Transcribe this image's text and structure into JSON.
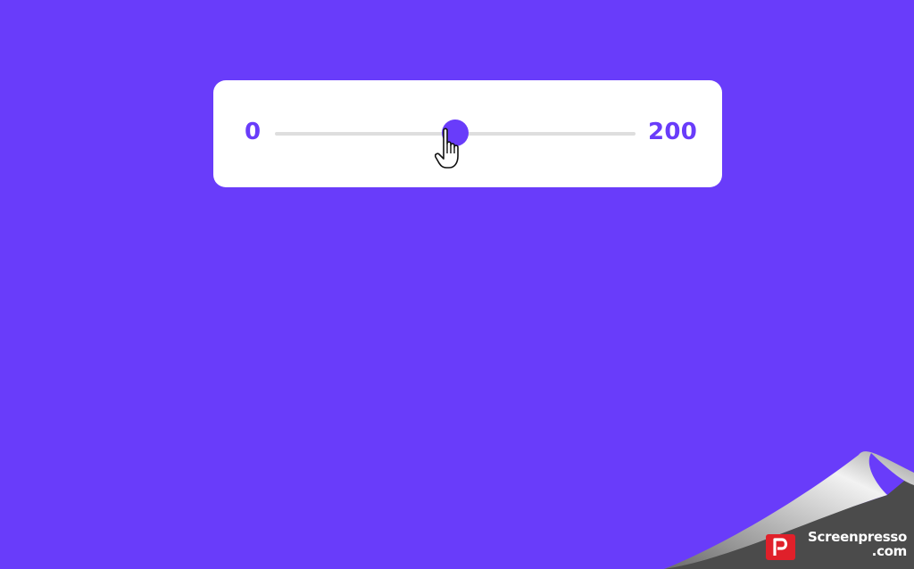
{
  "slider": {
    "min_label": "0",
    "max_label": "200",
    "min": 0,
    "max": 200,
    "value": 100,
    "accent_color": "#693cfa",
    "track_color": "#dedede"
  },
  "background_color": "#693cfa",
  "cursor_icon": "hand-pointer-icon",
  "watermark": {
    "line1": "Screenpresso",
    "line2": ".com",
    "logo_icon": "screenpresso-logo-icon"
  }
}
